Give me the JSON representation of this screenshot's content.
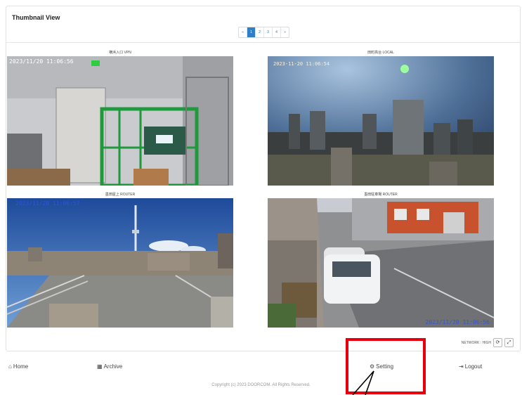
{
  "panel": {
    "title": "Thumbnail View"
  },
  "pagination": {
    "prev": "«",
    "pages": [
      "1",
      "2",
      "3",
      "4"
    ],
    "next": "»",
    "active": "1"
  },
  "cameras": [
    {
      "label": "横浜入口 VPN",
      "timestamp": "2023/11/20 11:06:56"
    },
    {
      "label": "田町高台 LOCAL",
      "timestamp": "2023-11-20 11:06:54"
    },
    {
      "label": "墨田屋上 ROUTER",
      "timestamp": "2023/11/20 11:06:57"
    },
    {
      "label": "墨田駐車場 ROUTER",
      "timestamp": "2023/11/20 11:06:56"
    }
  ],
  "network": {
    "label": "NETWORK : HIGH",
    "refresh_icon": "refresh-icon",
    "fullscreen_icon": "expand-icon"
  },
  "nav": {
    "home": "Home",
    "archive": "Archive",
    "setting": "Setting",
    "logout": "Logout"
  },
  "footer": {
    "copyright": "Copyright (c) 2023 DOORCOM. All Rights Reserved."
  },
  "colors": {
    "annotation": "#e8000e",
    "accent": "#2f7fc7"
  }
}
